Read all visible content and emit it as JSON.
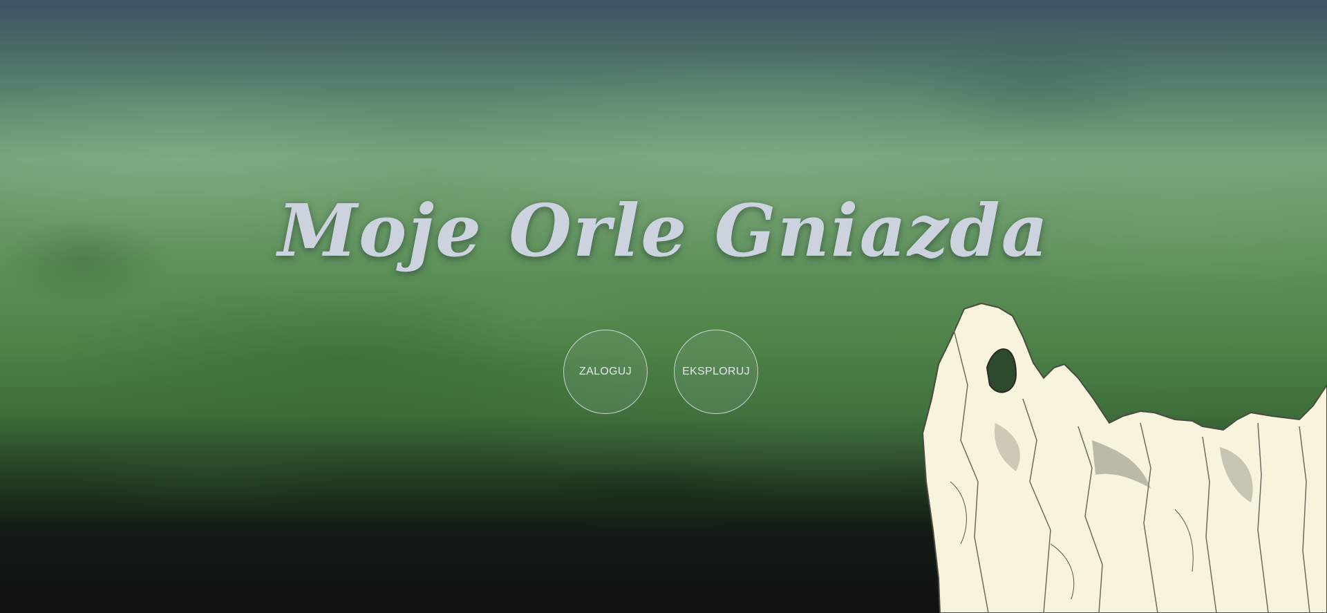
{
  "hero": {
    "title": "Moje Orle Gniazda"
  },
  "actions": {
    "login_label": "ZALOGUJ",
    "explore_label": "EKSPLORUJ"
  },
  "colors": {
    "title_text": "#ccd3df",
    "sky_top": "#3d5463",
    "green_mid": "#79a37a",
    "ground_dark": "#0f1310",
    "rock_paper": "#f7f3dc"
  },
  "decoration": {
    "illustration": "rock-formation-sketch"
  }
}
